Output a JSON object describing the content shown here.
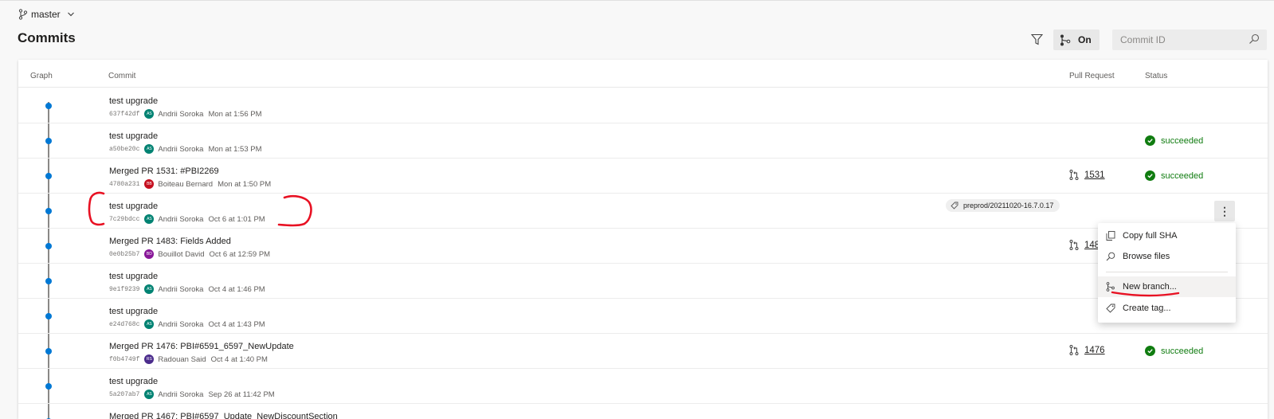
{
  "branch": {
    "name": "master"
  },
  "page": {
    "title": "Commits"
  },
  "toolbar": {
    "graph_toggle_label": "On",
    "search_placeholder": "Commit ID"
  },
  "columns": {
    "graph": "Graph",
    "commit": "Commit",
    "pull_request": "Pull Request",
    "status": "Status"
  },
  "commits": [
    {
      "message": "test upgrade",
      "sha": "637f42df",
      "initials": "AS",
      "author": "Andrii Soroka",
      "date": "Mon at 1:56 PM",
      "avatar_color": "#008272"
    },
    {
      "message": "test upgrade",
      "sha": "a50be20c",
      "initials": "AS",
      "author": "Andrii Soroka",
      "date": "Mon at 1:53 PM",
      "avatar_color": "#008272",
      "status": "succeeded"
    },
    {
      "message": "Merged PR 1531: #PBI2269",
      "sha": "4780a231",
      "initials": "BB",
      "author": "Boiteau Bernard",
      "date": "Mon at 1:50 PM",
      "avatar_color": "#c50f1f",
      "pr": "1531",
      "status": "succeeded"
    },
    {
      "message": "test upgrade",
      "sha": "7c29bdcc",
      "initials": "AS",
      "author": "Andrii Soroka",
      "date": "Oct 6 at 1:01 PM",
      "avatar_color": "#008272",
      "tag": "preprod/20211020-16.7.0.17"
    },
    {
      "message": "Merged PR 1483: Fields Added",
      "sha": "0e0b25b7",
      "initials": "BD",
      "author": "Bouillot David",
      "date": "Oct 6 at 12:59 PM",
      "avatar_color": "#881798",
      "pr": "148"
    },
    {
      "message": "test upgrade",
      "sha": "9e1f9239",
      "initials": "AS",
      "author": "Andrii Soroka",
      "date": "Oct 4 at 1:46 PM",
      "avatar_color": "#008272"
    },
    {
      "message": "test upgrade",
      "sha": "e24d768c",
      "initials": "AS",
      "author": "Andrii Soroka",
      "date": "Oct 4 at 1:43 PM",
      "avatar_color": "#008272"
    },
    {
      "message": "Merged PR 1476: PBI#6591_6597_NewUpdate",
      "sha": "f0b4749f",
      "initials": "RS",
      "author": "Radouan Said",
      "date": "Oct 4 at 1:40 PM",
      "avatar_color": "#4b2c8c",
      "pr": "1476",
      "status": "succeeded"
    },
    {
      "message": "test upgrade",
      "sha": "5a207ab7",
      "initials": "AS",
      "author": "Andrii Soroka",
      "date": "Sep 26 at 11:42 PM",
      "avatar_color": "#008272"
    },
    {
      "message": "Merged PR 1467: PBI#6597_Update_NewDiscountSection",
      "sha": "",
      "initials": "",
      "author": "",
      "date": "",
      "avatar_color": "#008272"
    }
  ],
  "context_menu": {
    "items": [
      {
        "label": "Copy full SHA",
        "icon": "copy-icon"
      },
      {
        "label": "Browse files",
        "icon": "search-icon"
      },
      {
        "label": "New branch...",
        "icon": "branch-icon"
      },
      {
        "label": "Create tag...",
        "icon": "tag-icon"
      }
    ]
  },
  "colors": {
    "accent": "#0078d4",
    "success": "#107c10",
    "annotation": "#e81123"
  }
}
